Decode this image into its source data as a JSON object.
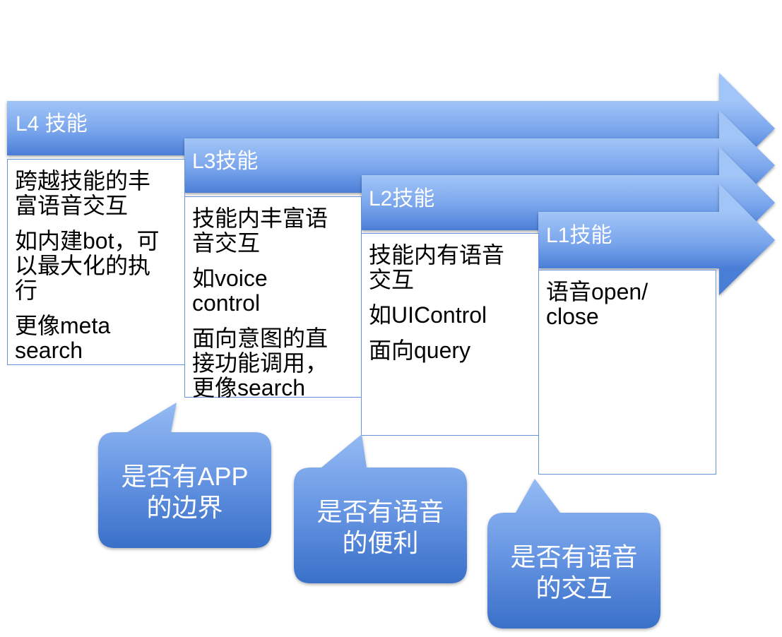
{
  "colors": {
    "arrow_light": "#a2c5f7",
    "arrow_mid": "#79a5ec",
    "arrow_dark": "#4a7ed6",
    "callout_light": "#94baf3",
    "callout_mid": "#6796e3",
    "callout_dark": "#3a70c9",
    "box_border": "#6793dc"
  },
  "levels": [
    {
      "label": "L4 技能",
      "paragraphs": [
        [
          "跨越技能的丰",
          "富语音交互"
        ],
        [
          "如内建bot，可",
          "以最大化的执",
          "行"
        ],
        [
          "更像meta",
          "search"
        ]
      ]
    },
    {
      "label": "L3技能",
      "paragraphs": [
        [
          "技能内丰富语",
          "音交互"
        ],
        [
          "如voice",
          "control"
        ],
        [
          "面向意图的直",
          "接功能调用，",
          "更像search"
        ]
      ]
    },
    {
      "label": "L2技能",
      "paragraphs": [
        [
          "技能内有语音",
          "交互"
        ],
        [
          "如UIControl"
        ],
        [
          "面向query"
        ]
      ]
    },
    {
      "label": "L1技能",
      "paragraphs": [
        [
          "语音open/",
          "close"
        ]
      ]
    }
  ],
  "callouts": [
    {
      "lines": [
        "是否有APP",
        "的边界"
      ]
    },
    {
      "lines": [
        "是否有语音",
        "的便利"
      ]
    },
    {
      "lines": [
        "是否有语音",
        "的交互"
      ]
    }
  ]
}
